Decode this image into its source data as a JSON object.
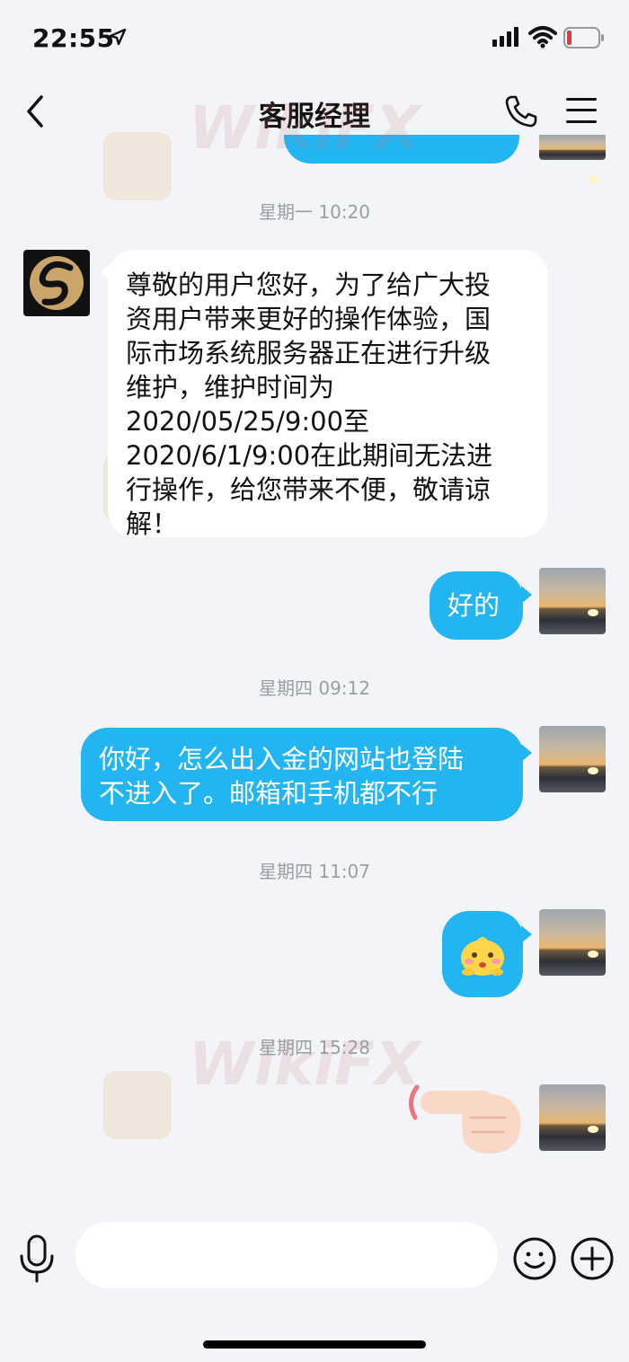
{
  "status_bar": {
    "time": "22:55"
  },
  "header": {
    "title": "客服经理"
  },
  "watermark": {
    "text": "WikiFX"
  },
  "messages": {
    "ts1": "星期一 10:20",
    "incoming1_lines": [
      "尊敬的用户您好，为了给广大投",
      "资用户带来更好的操作体验，国",
      "际市场系统服务器正在进行升级",
      "维护，维护时间为",
      "2020/05/25/9:00至",
      "2020/6/1/9:00在此期间无法进",
      "行操作，给您带来不便，敬请谅",
      "解！"
    ],
    "outgoing1": "好的",
    "ts2": "星期四 09:12",
    "outgoing2_lines": [
      "你好，怎么出入金的网站也登陆",
      "不进入了。邮箱和手机都不行"
    ],
    "ts3": "星期四 11:07",
    "ts4": "星期四 15:28"
  },
  "icons": {
    "back": "chevron-left-icon",
    "call": "phone-icon",
    "menu": "hamburger-menu-icon",
    "mic": "microphone-icon",
    "emoji": "smiley-icon",
    "plus": "plus-icon"
  },
  "colors": {
    "accent": "#22b5f2",
    "background": "#f3f4f8"
  }
}
